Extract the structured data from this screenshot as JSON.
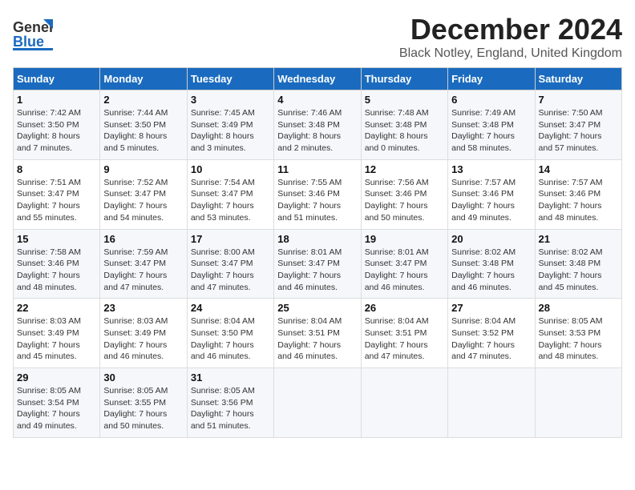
{
  "header": {
    "logo_line1": "General",
    "logo_line2": "Blue",
    "title": "December 2024",
    "subtitle": "Black Notley, England, United Kingdom"
  },
  "days_of_week": [
    "Sunday",
    "Monday",
    "Tuesday",
    "Wednesday",
    "Thursday",
    "Friday",
    "Saturday"
  ],
  "weeks": [
    [
      {
        "day": 1,
        "sunrise": "7:42 AM",
        "sunset": "3:50 PM",
        "daylight": "8 hours and 7 minutes."
      },
      {
        "day": 2,
        "sunrise": "7:44 AM",
        "sunset": "3:50 PM",
        "daylight": "8 hours and 5 minutes."
      },
      {
        "day": 3,
        "sunrise": "7:45 AM",
        "sunset": "3:49 PM",
        "daylight": "8 hours and 3 minutes."
      },
      {
        "day": 4,
        "sunrise": "7:46 AM",
        "sunset": "3:48 PM",
        "daylight": "8 hours and 2 minutes."
      },
      {
        "day": 5,
        "sunrise": "7:48 AM",
        "sunset": "3:48 PM",
        "daylight": "8 hours and 0 minutes."
      },
      {
        "day": 6,
        "sunrise": "7:49 AM",
        "sunset": "3:48 PM",
        "daylight": "7 hours and 58 minutes."
      },
      {
        "day": 7,
        "sunrise": "7:50 AM",
        "sunset": "3:47 PM",
        "daylight": "7 hours and 57 minutes."
      }
    ],
    [
      {
        "day": 8,
        "sunrise": "7:51 AM",
        "sunset": "3:47 PM",
        "daylight": "7 hours and 55 minutes."
      },
      {
        "day": 9,
        "sunrise": "7:52 AM",
        "sunset": "3:47 PM",
        "daylight": "7 hours and 54 minutes."
      },
      {
        "day": 10,
        "sunrise": "7:54 AM",
        "sunset": "3:47 PM",
        "daylight": "7 hours and 53 minutes."
      },
      {
        "day": 11,
        "sunrise": "7:55 AM",
        "sunset": "3:46 PM",
        "daylight": "7 hours and 51 minutes."
      },
      {
        "day": 12,
        "sunrise": "7:56 AM",
        "sunset": "3:46 PM",
        "daylight": "7 hours and 50 minutes."
      },
      {
        "day": 13,
        "sunrise": "7:57 AM",
        "sunset": "3:46 PM",
        "daylight": "7 hours and 49 minutes."
      },
      {
        "day": 14,
        "sunrise": "7:57 AM",
        "sunset": "3:46 PM",
        "daylight": "7 hours and 48 minutes."
      }
    ],
    [
      {
        "day": 15,
        "sunrise": "7:58 AM",
        "sunset": "3:46 PM",
        "daylight": "7 hours and 48 minutes."
      },
      {
        "day": 16,
        "sunrise": "7:59 AM",
        "sunset": "3:47 PM",
        "daylight": "7 hours and 47 minutes."
      },
      {
        "day": 17,
        "sunrise": "8:00 AM",
        "sunset": "3:47 PM",
        "daylight": "7 hours and 47 minutes."
      },
      {
        "day": 18,
        "sunrise": "8:01 AM",
        "sunset": "3:47 PM",
        "daylight": "7 hours and 46 minutes."
      },
      {
        "day": 19,
        "sunrise": "8:01 AM",
        "sunset": "3:47 PM",
        "daylight": "7 hours and 46 minutes."
      },
      {
        "day": 20,
        "sunrise": "8:02 AM",
        "sunset": "3:48 PM",
        "daylight": "7 hours and 46 minutes."
      },
      {
        "day": 21,
        "sunrise": "8:02 AM",
        "sunset": "3:48 PM",
        "daylight": "7 hours and 45 minutes."
      }
    ],
    [
      {
        "day": 22,
        "sunrise": "8:03 AM",
        "sunset": "3:49 PM",
        "daylight": "7 hours and 45 minutes."
      },
      {
        "day": 23,
        "sunrise": "8:03 AM",
        "sunset": "3:49 PM",
        "daylight": "7 hours and 46 minutes."
      },
      {
        "day": 24,
        "sunrise": "8:04 AM",
        "sunset": "3:50 PM",
        "daylight": "7 hours and 46 minutes."
      },
      {
        "day": 25,
        "sunrise": "8:04 AM",
        "sunset": "3:51 PM",
        "daylight": "7 hours and 46 minutes."
      },
      {
        "day": 26,
        "sunrise": "8:04 AM",
        "sunset": "3:51 PM",
        "daylight": "7 hours and 47 minutes."
      },
      {
        "day": 27,
        "sunrise": "8:04 AM",
        "sunset": "3:52 PM",
        "daylight": "7 hours and 47 minutes."
      },
      {
        "day": 28,
        "sunrise": "8:05 AM",
        "sunset": "3:53 PM",
        "daylight": "7 hours and 48 minutes."
      }
    ],
    [
      {
        "day": 29,
        "sunrise": "8:05 AM",
        "sunset": "3:54 PM",
        "daylight": "7 hours and 49 minutes."
      },
      {
        "day": 30,
        "sunrise": "8:05 AM",
        "sunset": "3:55 PM",
        "daylight": "7 hours and 50 minutes."
      },
      {
        "day": 31,
        "sunrise": "8:05 AM",
        "sunset": "3:56 PM",
        "daylight": "7 hours and 51 minutes."
      },
      null,
      null,
      null,
      null
    ]
  ]
}
